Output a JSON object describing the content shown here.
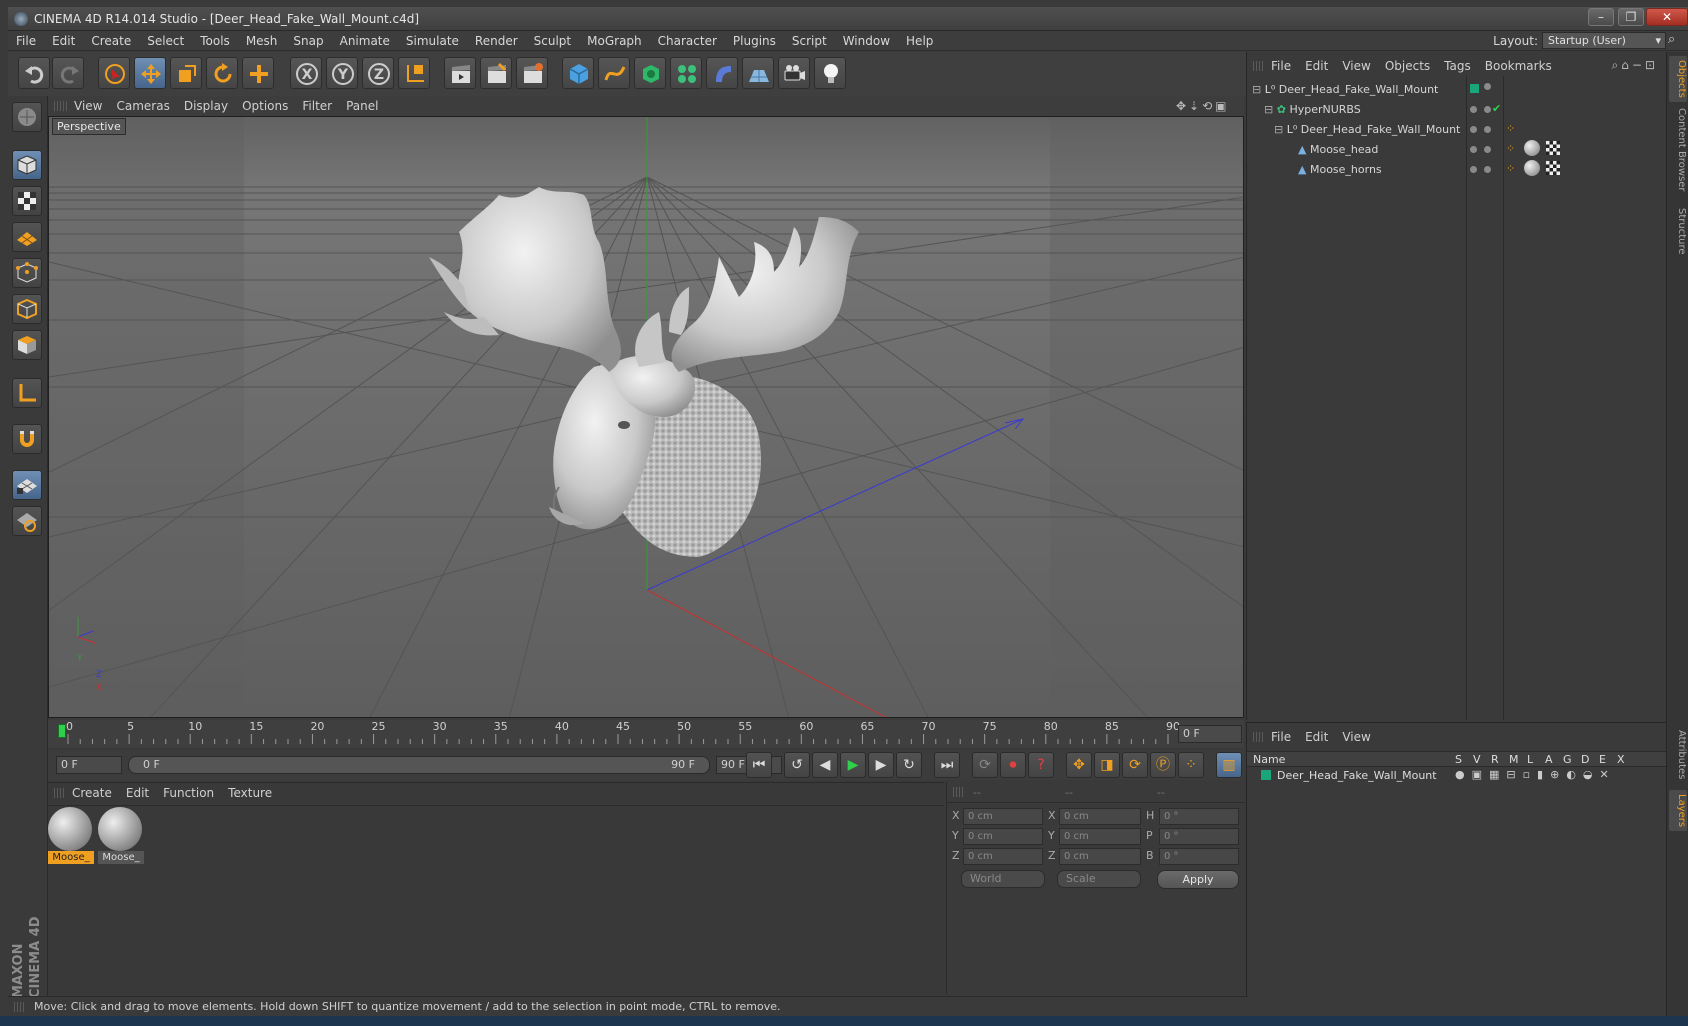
{
  "window": {
    "title": "CINEMA 4D R14.014 Studio - [Deer_Head_Fake_Wall_Mount.c4d]",
    "minimize": "–",
    "restore": "❐",
    "close": "✕"
  },
  "menu": [
    "File",
    "Edit",
    "Create",
    "Select",
    "Tools",
    "Mesh",
    "Snap",
    "Animate",
    "Simulate",
    "Render",
    "Sculpt",
    "MoGraph",
    "Character",
    "Plugins",
    "Script",
    "Window",
    "Help"
  ],
  "layout": {
    "label": "Layout:",
    "value": "Startup (User)"
  },
  "viewport": {
    "menu": [
      "View",
      "Cameras",
      "Display",
      "Options",
      "Filter",
      "Panel"
    ],
    "label": "Perspective",
    "axis_y": "Y",
    "axis_z": "Z",
    "axis_x": "X"
  },
  "timeline": {
    "ticks": [
      "0",
      "5",
      "10",
      "15",
      "20",
      "25",
      "30",
      "35",
      "40",
      "45",
      "50",
      "55",
      "60",
      "65",
      "70",
      "75",
      "80",
      "85",
      "90"
    ],
    "current_frame": "0 F",
    "start_field": "0 F",
    "range_start": "0 F",
    "range_end": "90 F",
    "end_field": "90 F"
  },
  "materials": {
    "menu": [
      "Create",
      "Edit",
      "Function",
      "Texture"
    ],
    "items": [
      {
        "label": "Moose_"
      },
      {
        "label": "Moose_"
      }
    ]
  },
  "coordinates": {
    "headers": [
      "--",
      "--",
      "--"
    ],
    "rows": [
      {
        "l1": "X",
        "v1": "0 cm",
        "l2": "X",
        "v2": "0 cm",
        "l3": "H",
        "v3": "0 °"
      },
      {
        "l1": "Y",
        "v1": "0 cm",
        "l2": "Y",
        "v2": "0 cm",
        "l3": "P",
        "v3": "0 °"
      },
      {
        "l1": "Z",
        "v1": "0 cm",
        "l2": "Z",
        "v2": "0 cm",
        "l3": "B",
        "v3": "0 °"
      }
    ],
    "mode": "World",
    "scale": "Scale",
    "apply": "Apply"
  },
  "objects": {
    "menu": [
      "File",
      "Edit",
      "View",
      "Objects",
      "Tags",
      "Bookmarks"
    ],
    "tree": [
      {
        "name": "Deer_Head_Fake_Wall_Mount",
        "depth": 0
      },
      {
        "name": "HyperNURBS",
        "depth": 1
      },
      {
        "name": "Deer_Head_Fake_Wall_Mount",
        "depth": 2
      },
      {
        "name": "Moose_head",
        "depth": 3
      },
      {
        "name": "Moose_horns",
        "depth": 3
      }
    ]
  },
  "layers": {
    "menu": [
      "File",
      "Edit",
      "View"
    ],
    "name_header": "Name",
    "columns": [
      "S",
      "V",
      "R",
      "M",
      "L",
      "A",
      "G",
      "D",
      "E",
      "X"
    ],
    "rows": [
      {
        "name": "Deer_Head_Fake_Wall_Mount"
      }
    ]
  },
  "side_tabs": [
    "Objects",
    "Content Browser",
    "Structure",
    "Attributes",
    "Layers"
  ],
  "brand": {
    "line1": "MAXON",
    "line2": "CINEMA 4D"
  },
  "status": "Move: Click and drag to move elements. Hold down SHIFT to quantize movement / add to the selection in point mode, CTRL to remove.",
  "colors": {
    "accent": "#f0a020",
    "selected_tool": "#5a7aa0",
    "layer_green": "#1aa57a"
  }
}
